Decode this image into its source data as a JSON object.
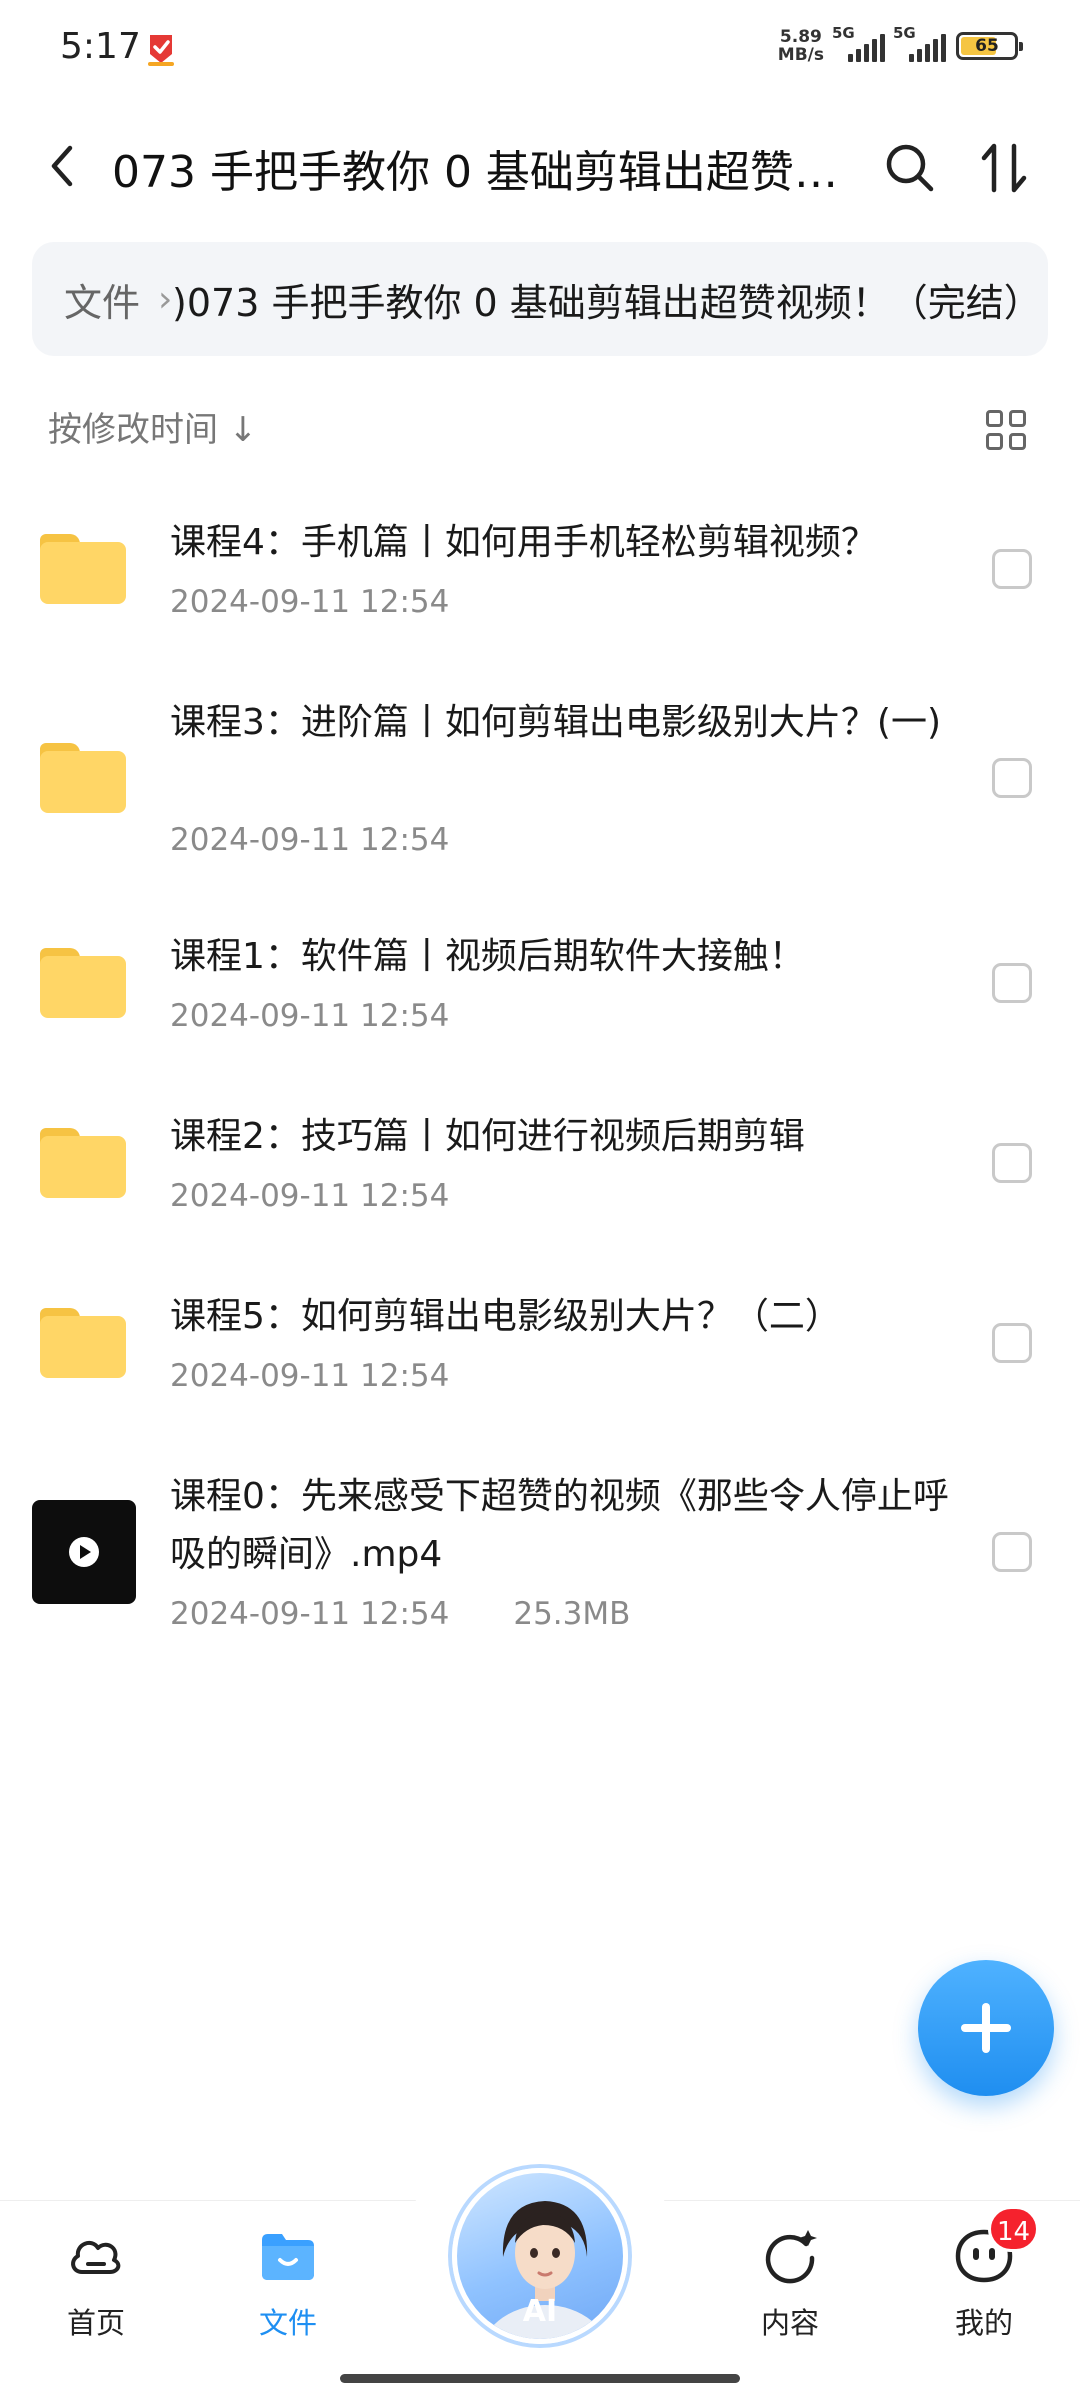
{
  "status_bar": {
    "time": "5:17",
    "net_speed_value": "5.89",
    "net_speed_unit": "MB/s",
    "signal_1": "5G",
    "signal_2": "5G",
    "battery": "65",
    "battery_level": 0.65,
    "battery_color": "#f5c542"
  },
  "header": {
    "title": "073 手把手教你 0 基础剪辑出超赞视频！（完结）",
    "back_icon": "chevron-left-icon",
    "search_icon": "search-icon",
    "sort_icon": "sort-icon"
  },
  "breadcrumb": {
    "root": "文件",
    "current": ")073 手把手教你 0 基础剪辑出超赞视频！（完结）"
  },
  "sort_bar": {
    "label": "按修改时间 ↓",
    "view_icon": "grid-view-icon"
  },
  "files": [
    {
      "type": "folder",
      "name": "课程4：手机篇丨如何用手机轻松剪辑视频？",
      "date": "2024-09-11 12:54",
      "size": ""
    },
    {
      "type": "folder",
      "name": "课程3：进阶篇丨如何剪辑出电影级别大片？(一)",
      "date": "2024-09-11 12:54",
      "size": ""
    },
    {
      "type": "folder",
      "name": "课程1：软件篇丨视频后期软件大接触！",
      "date": "2024-09-11 12:54",
      "size": ""
    },
    {
      "type": "folder",
      "name": "课程2：技巧篇丨如何进行视频后期剪辑",
      "date": "2024-09-11 12:54",
      "size": ""
    },
    {
      "type": "folder",
      "name": "课程5：如何剪辑出电影级别大片？（二）",
      "date": "2024-09-11 12:54",
      "size": ""
    },
    {
      "type": "video",
      "name": "课程0：先来感受下超赞的视频《那些令人停止呼吸的瞬间》.mp4",
      "date": "2024-09-11 12:54",
      "size": "25.3MB"
    }
  ],
  "fab": {
    "icon": "plus-icon"
  },
  "bottom_nav": {
    "home_label": "首页",
    "files_label": "文件",
    "ai_label": "AI",
    "content_label": "内容",
    "mine_label": "我的",
    "mine_badge": "14",
    "active_color": "#1e8ff2",
    "badge_color": "#f5222d"
  }
}
